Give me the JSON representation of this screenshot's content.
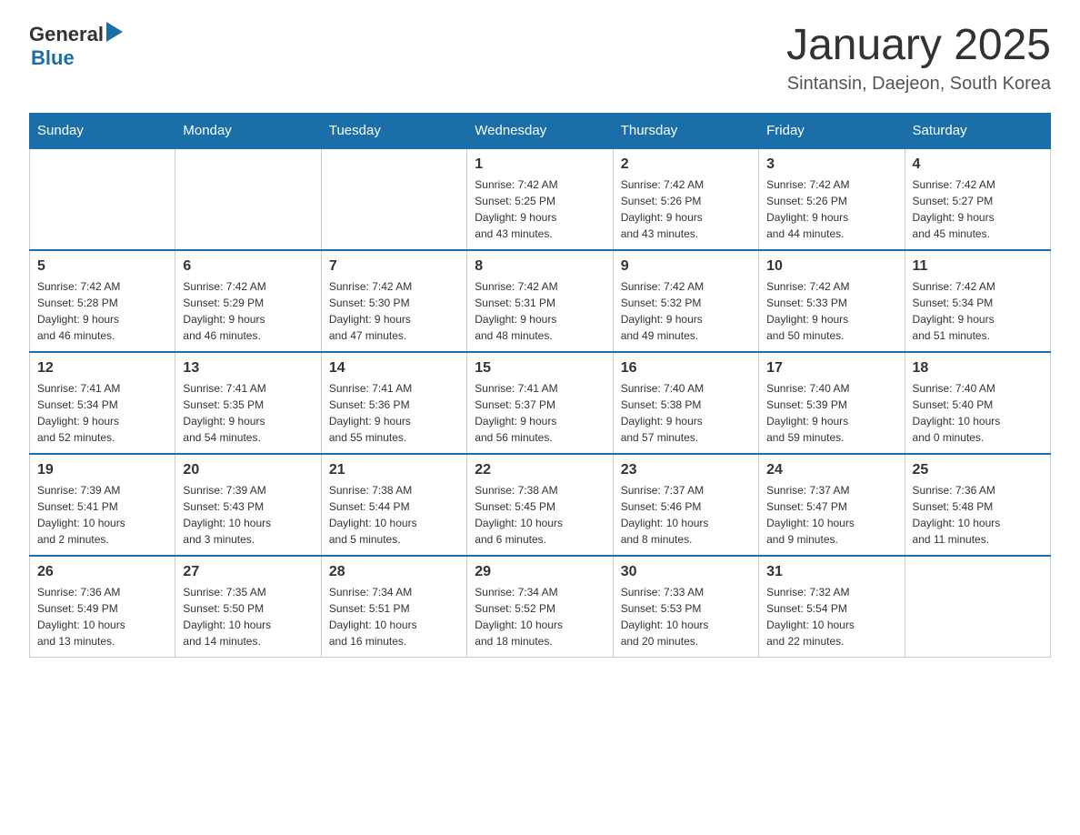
{
  "header": {
    "logo_general": "General",
    "logo_blue": "Blue",
    "title": "January 2025",
    "subtitle": "Sintansin, Daejeon, South Korea"
  },
  "weekdays": [
    "Sunday",
    "Monday",
    "Tuesday",
    "Wednesday",
    "Thursday",
    "Friday",
    "Saturday"
  ],
  "weeks": [
    [
      {
        "day": "",
        "info": ""
      },
      {
        "day": "",
        "info": ""
      },
      {
        "day": "",
        "info": ""
      },
      {
        "day": "1",
        "info": "Sunrise: 7:42 AM\nSunset: 5:25 PM\nDaylight: 9 hours\nand 43 minutes."
      },
      {
        "day": "2",
        "info": "Sunrise: 7:42 AM\nSunset: 5:26 PM\nDaylight: 9 hours\nand 43 minutes."
      },
      {
        "day": "3",
        "info": "Sunrise: 7:42 AM\nSunset: 5:26 PM\nDaylight: 9 hours\nand 44 minutes."
      },
      {
        "day": "4",
        "info": "Sunrise: 7:42 AM\nSunset: 5:27 PM\nDaylight: 9 hours\nand 45 minutes."
      }
    ],
    [
      {
        "day": "5",
        "info": "Sunrise: 7:42 AM\nSunset: 5:28 PM\nDaylight: 9 hours\nand 46 minutes."
      },
      {
        "day": "6",
        "info": "Sunrise: 7:42 AM\nSunset: 5:29 PM\nDaylight: 9 hours\nand 46 minutes."
      },
      {
        "day": "7",
        "info": "Sunrise: 7:42 AM\nSunset: 5:30 PM\nDaylight: 9 hours\nand 47 minutes."
      },
      {
        "day": "8",
        "info": "Sunrise: 7:42 AM\nSunset: 5:31 PM\nDaylight: 9 hours\nand 48 minutes."
      },
      {
        "day": "9",
        "info": "Sunrise: 7:42 AM\nSunset: 5:32 PM\nDaylight: 9 hours\nand 49 minutes."
      },
      {
        "day": "10",
        "info": "Sunrise: 7:42 AM\nSunset: 5:33 PM\nDaylight: 9 hours\nand 50 minutes."
      },
      {
        "day": "11",
        "info": "Sunrise: 7:42 AM\nSunset: 5:34 PM\nDaylight: 9 hours\nand 51 minutes."
      }
    ],
    [
      {
        "day": "12",
        "info": "Sunrise: 7:41 AM\nSunset: 5:34 PM\nDaylight: 9 hours\nand 52 minutes."
      },
      {
        "day": "13",
        "info": "Sunrise: 7:41 AM\nSunset: 5:35 PM\nDaylight: 9 hours\nand 54 minutes."
      },
      {
        "day": "14",
        "info": "Sunrise: 7:41 AM\nSunset: 5:36 PM\nDaylight: 9 hours\nand 55 minutes."
      },
      {
        "day": "15",
        "info": "Sunrise: 7:41 AM\nSunset: 5:37 PM\nDaylight: 9 hours\nand 56 minutes."
      },
      {
        "day": "16",
        "info": "Sunrise: 7:40 AM\nSunset: 5:38 PM\nDaylight: 9 hours\nand 57 minutes."
      },
      {
        "day": "17",
        "info": "Sunrise: 7:40 AM\nSunset: 5:39 PM\nDaylight: 9 hours\nand 59 minutes."
      },
      {
        "day": "18",
        "info": "Sunrise: 7:40 AM\nSunset: 5:40 PM\nDaylight: 10 hours\nand 0 minutes."
      }
    ],
    [
      {
        "day": "19",
        "info": "Sunrise: 7:39 AM\nSunset: 5:41 PM\nDaylight: 10 hours\nand 2 minutes."
      },
      {
        "day": "20",
        "info": "Sunrise: 7:39 AM\nSunset: 5:43 PM\nDaylight: 10 hours\nand 3 minutes."
      },
      {
        "day": "21",
        "info": "Sunrise: 7:38 AM\nSunset: 5:44 PM\nDaylight: 10 hours\nand 5 minutes."
      },
      {
        "day": "22",
        "info": "Sunrise: 7:38 AM\nSunset: 5:45 PM\nDaylight: 10 hours\nand 6 minutes."
      },
      {
        "day": "23",
        "info": "Sunrise: 7:37 AM\nSunset: 5:46 PM\nDaylight: 10 hours\nand 8 minutes."
      },
      {
        "day": "24",
        "info": "Sunrise: 7:37 AM\nSunset: 5:47 PM\nDaylight: 10 hours\nand 9 minutes."
      },
      {
        "day": "25",
        "info": "Sunrise: 7:36 AM\nSunset: 5:48 PM\nDaylight: 10 hours\nand 11 minutes."
      }
    ],
    [
      {
        "day": "26",
        "info": "Sunrise: 7:36 AM\nSunset: 5:49 PM\nDaylight: 10 hours\nand 13 minutes."
      },
      {
        "day": "27",
        "info": "Sunrise: 7:35 AM\nSunset: 5:50 PM\nDaylight: 10 hours\nand 14 minutes."
      },
      {
        "day": "28",
        "info": "Sunrise: 7:34 AM\nSunset: 5:51 PM\nDaylight: 10 hours\nand 16 minutes."
      },
      {
        "day": "29",
        "info": "Sunrise: 7:34 AM\nSunset: 5:52 PM\nDaylight: 10 hours\nand 18 minutes."
      },
      {
        "day": "30",
        "info": "Sunrise: 7:33 AM\nSunset: 5:53 PM\nDaylight: 10 hours\nand 20 minutes."
      },
      {
        "day": "31",
        "info": "Sunrise: 7:32 AM\nSunset: 5:54 PM\nDaylight: 10 hours\nand 22 minutes."
      },
      {
        "day": "",
        "info": ""
      }
    ]
  ]
}
